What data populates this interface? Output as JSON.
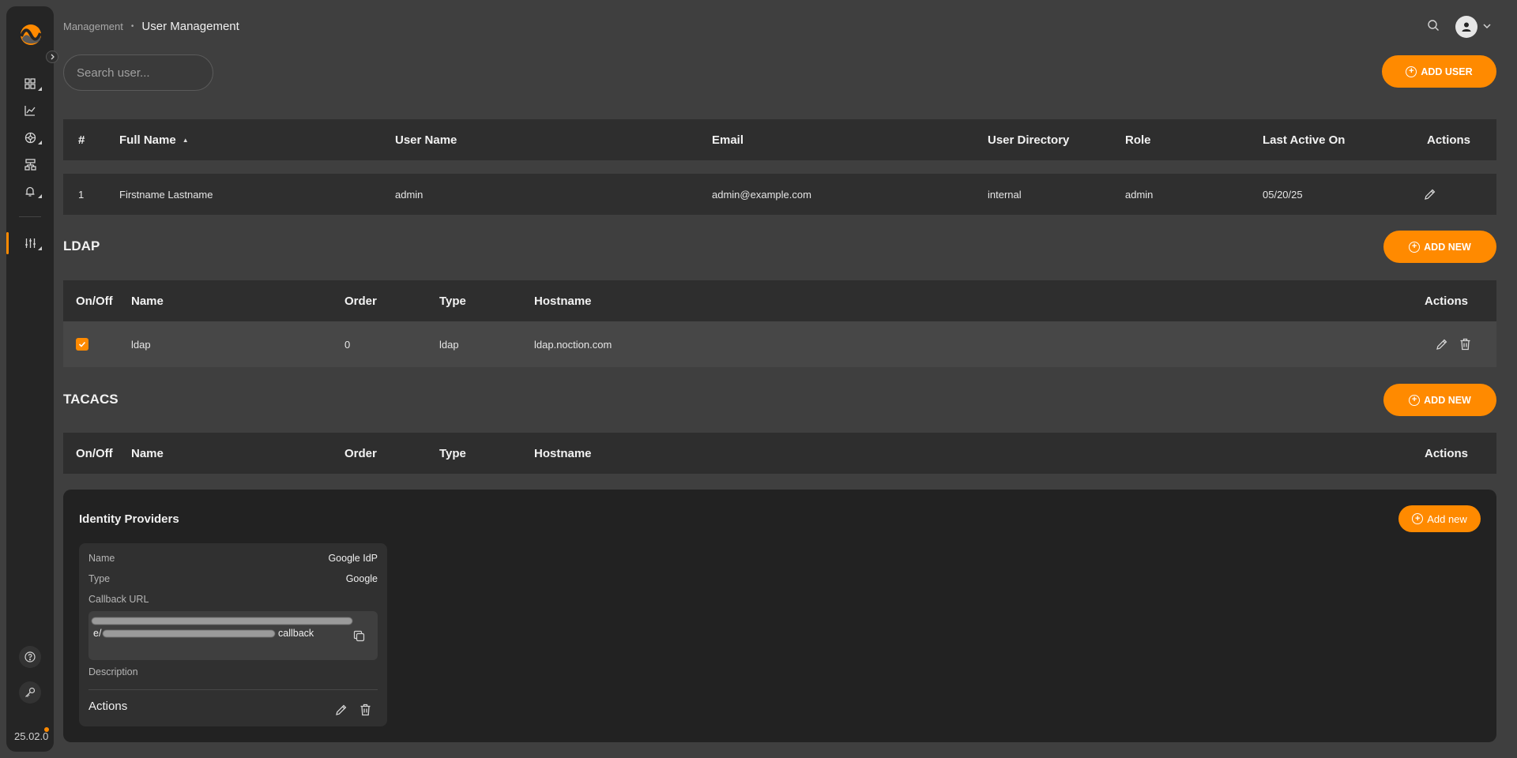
{
  "sidebar": {
    "version": "25.02.0",
    "items": [
      {
        "name": "dashboard",
        "has_submenu": true
      },
      {
        "name": "analytics",
        "has_submenu": false
      },
      {
        "name": "network",
        "has_submenu": true
      },
      {
        "name": "hierarchy",
        "has_submenu": false
      },
      {
        "name": "notifications",
        "has_submenu": true
      },
      {
        "name": "settings",
        "has_submenu": true,
        "active": true
      }
    ]
  },
  "header": {
    "breadcrumb_parent": "Management",
    "breadcrumb_current": "User Management"
  },
  "search": {
    "placeholder": "Search user..."
  },
  "users": {
    "add_label": "ADD USER",
    "columns": [
      "#",
      "Full Name",
      "User Name",
      "Email",
      "User Directory",
      "Role",
      "Last Active On",
      "Actions"
    ],
    "rows": [
      {
        "num": "1",
        "full_name": "Firstname Lastname",
        "user_name": "admin",
        "email": "admin@example.com",
        "directory": "internal",
        "role": "admin",
        "last_active": "05/20/25"
      }
    ]
  },
  "ldap": {
    "title": "LDAP",
    "add_label": "ADD NEW",
    "columns": [
      "On/Off",
      "Name",
      "Order",
      "Type",
      "Hostname",
      "Actions"
    ],
    "rows": [
      {
        "enabled": true,
        "name": "ldap",
        "order": "0",
        "type": "ldap",
        "hostname": "ldap.noction.com"
      }
    ]
  },
  "tacacs": {
    "title": "TACACS",
    "add_label": "ADD NEW",
    "columns": [
      "On/Off",
      "Name",
      "Order",
      "Type",
      "Hostname",
      "Actions"
    ]
  },
  "identity_providers": {
    "title": "Identity Providers",
    "add_label": "Add new",
    "card": {
      "name_label": "Name",
      "name_value": "Google IdP",
      "type_label": "Type",
      "type_value": "Google",
      "callback_label": "Callback URL",
      "callback_prefix": "e/",
      "callback_suffix": "callback",
      "description_label": "Description",
      "actions_label": "Actions"
    }
  },
  "colors": {
    "accent": "#ff8a00",
    "background": "#3f3f3f",
    "sidebar": "#252525",
    "panel": "#222222"
  }
}
